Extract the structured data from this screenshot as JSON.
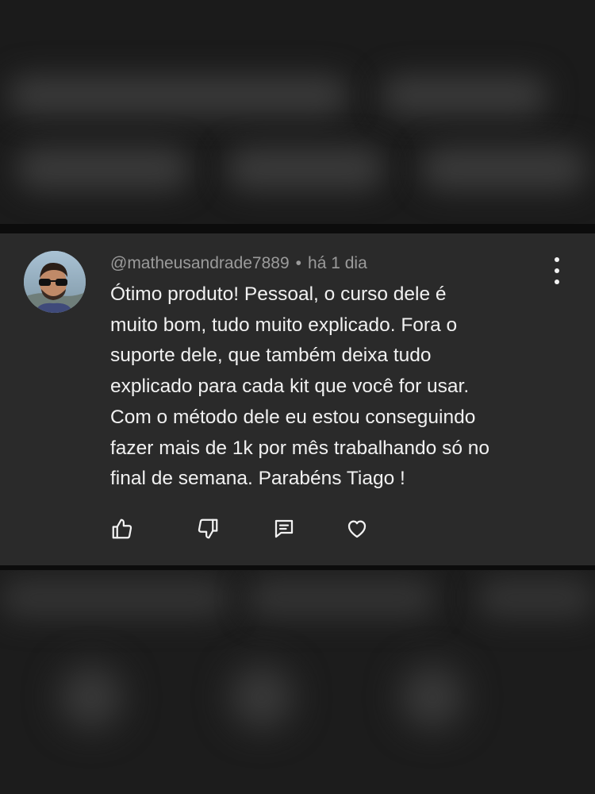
{
  "comment": {
    "username": "@matheusandrade7889",
    "separator": "•",
    "timestamp": "há 1 dia",
    "text_lines": [
      "Ótimo produto! Pessoal, o curso dele é",
      "muito bom, tudo muito explicado. Fora o",
      "suporte dele, que também deixa tudo",
      "explicado para cada kit que você for usar.",
      "Com o método dele eu estou conseguindo",
      "fazer mais de 1k por mês trabalhando só no",
      "final de semana. Parabéns Tiago !"
    ]
  },
  "icons": {
    "like": "thumbs-up-icon",
    "dislike": "thumbs-down-icon",
    "reply": "reply-icon",
    "heart": "heart-icon",
    "menu": "more-vertical-icon"
  },
  "colors": {
    "card_background": "#2a2a2a",
    "text": "#f1f1f1",
    "meta_text": "#9b9b9b",
    "icon": "#f2f2f2"
  }
}
